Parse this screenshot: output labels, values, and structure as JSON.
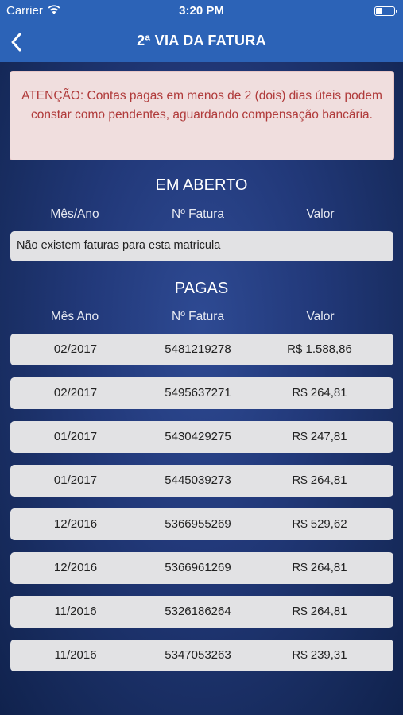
{
  "status_bar": {
    "carrier": "Carrier",
    "time": "3:20 PM"
  },
  "nav": {
    "title": "2ª VIA DA FATURA"
  },
  "alert": {
    "text": "ATENÇÃO: Contas pagas em menos de 2 (dois) dias úteis podem constar como pendentes, aguardando compensação bancária."
  },
  "open_section": {
    "title": "EM ABERTO",
    "headers": [
      "Mês/Ano",
      "Nº Fatura",
      "Valor"
    ],
    "empty_message": "Não existem faturas para esta matricula"
  },
  "paid_section": {
    "title": "PAGAS",
    "headers": [
      "Mês Ano",
      "Nº Fatura",
      "Valor"
    ],
    "rows": [
      {
        "month": "02/2017",
        "invoice": "5481219278",
        "value": "R$ 1.588,86"
      },
      {
        "month": "02/2017",
        "invoice": "5495637271",
        "value": "R$ 264,81"
      },
      {
        "month": "01/2017",
        "invoice": "5430429275",
        "value": "R$ 247,81"
      },
      {
        "month": "01/2017",
        "invoice": "5445039273",
        "value": "R$ 264,81"
      },
      {
        "month": "12/2016",
        "invoice": "5366955269",
        "value": "R$ 529,62"
      },
      {
        "month": "12/2016",
        "invoice": "5366961269",
        "value": "R$ 264,81"
      },
      {
        "month": "11/2016",
        "invoice": "5326186264",
        "value": "R$ 264,81"
      },
      {
        "month": "11/2016",
        "invoice": "5347053263",
        "value": "R$ 239,31"
      }
    ]
  },
  "colors": {
    "nav_blue": "#2c63b7",
    "alert_bg": "#f0dede",
    "alert_text": "#b03a3a",
    "row_bg": "#e2e2e4"
  },
  "icons": {
    "back": "chevron-left-icon",
    "wifi": "wifi-icon",
    "battery": "battery-icon"
  }
}
